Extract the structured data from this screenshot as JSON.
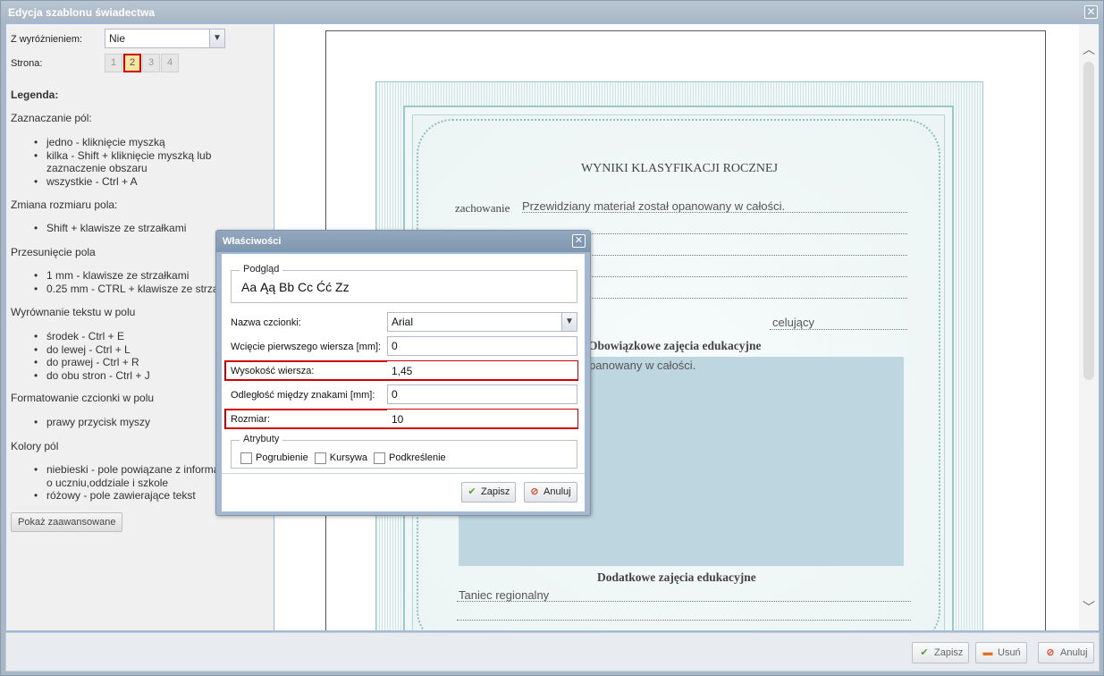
{
  "window": {
    "title": "Edycja szablonu świadectwa",
    "close_glyph": "✕"
  },
  "left": {
    "distinction_label": "Z wyróżnieniem:",
    "distinction_value": "Nie",
    "page_label": "Strona:",
    "pages": [
      "1",
      "2",
      "3",
      "4"
    ],
    "active_page": "2",
    "legend_title": "Legenda:",
    "sections": [
      {
        "title": "Zaznaczanie pól:",
        "items": [
          "jedno - kliknięcie myszką",
          "kilka - Shift + kliknięcie myszką lub",
          "zaznaczenie obszaru",
          "wszystkie - Ctrl + A"
        ]
      },
      {
        "title": "Zmiana rozmiaru pola:",
        "items": [
          "Shift + klawisze ze strzałkami"
        ]
      },
      {
        "title": "Przesunięcie pola",
        "items": [
          "1 mm - klawisze ze strzałkami",
          "0.25 mm - CTRL + klawisze ze strza"
        ]
      },
      {
        "title": "Wyrównanie tekstu w polu",
        "items": [
          "środek - Ctrl + E",
          "do lewej - Ctrl + L",
          "do prawej - Ctrl + R",
          "do obu stron - Ctrl + J"
        ]
      },
      {
        "title": "Formatowanie czcionki w polu",
        "items": [
          "prawy przycisk myszy"
        ]
      },
      {
        "title": "Kolory pól",
        "items": [
          "niebieski - pole powiązane z informa",
          "o uczniu,oddziale i szkole",
          "różowy - pole zawierające tekst"
        ]
      }
    ],
    "advanced_button": "Pokaż zaawansowane"
  },
  "certificate": {
    "title": "WYNIKI KLASYFIKACJI ROCZNEJ",
    "behavior_label": "zachowanie",
    "behavior_value": "Przewidziany materiał został opanowany w całości.",
    "grade": "celujący",
    "mandatory_heading": "Obowiązkowe zajęcia edukacyjne",
    "mandatory_text": "stał opanowany w całości.",
    "additional_heading": "Dodatkowe zajęcia edukacyjne",
    "additional_value": "Taniec regionalny"
  },
  "scrollbar": {
    "up_icon": "chevron-up-icon",
    "down_icon": "chevron-down-icon"
  },
  "footer": {
    "save": "Zapisz",
    "delete": "Usuń",
    "cancel": "Anuluj"
  },
  "dialog": {
    "title": "Właściwości",
    "preview_legend": "Podgląd",
    "preview_text": "Aa Ąą Bb Cc Ćć Zz",
    "font_name_label": "Nazwa czcionki:",
    "font_name_value": "Arial",
    "indent_label": "Wcięcie pierwszego wiersza [mm]:",
    "indent_value": "0",
    "line_height_label": "Wysokość wiersza:",
    "line_height_value": "1,45",
    "spacing_label": "Odległość między znakami [mm]:",
    "spacing_value": "0",
    "size_label": "Rozmiar:",
    "size_value": "10",
    "attributes_legend": "Atrybuty",
    "bold_label": "Pogrubienie",
    "italic_label": "Kursywa",
    "underline_label": "Podkreślenie",
    "save_button": "Zapisz",
    "cancel_button": "Anuluj"
  },
  "colors": {
    "highlight": "#d00000",
    "field_blue": "#bed6df",
    "active_page_bg": "#f6e5a0"
  }
}
